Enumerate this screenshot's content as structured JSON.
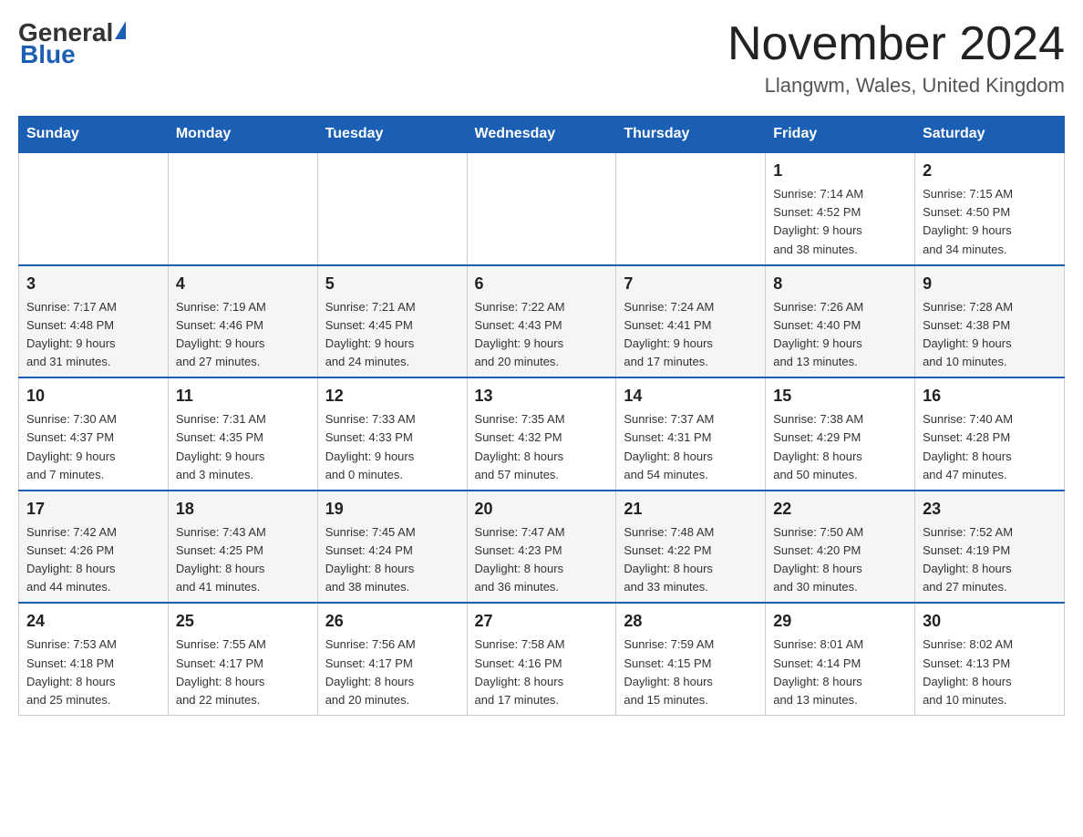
{
  "header": {
    "logo_general": "General",
    "logo_blue": "Blue",
    "month_title": "November 2024",
    "location": "Llangwm, Wales, United Kingdom"
  },
  "weekdays": [
    "Sunday",
    "Monday",
    "Tuesday",
    "Wednesday",
    "Thursday",
    "Friday",
    "Saturday"
  ],
  "weeks": [
    [
      {
        "day": "",
        "info": ""
      },
      {
        "day": "",
        "info": ""
      },
      {
        "day": "",
        "info": ""
      },
      {
        "day": "",
        "info": ""
      },
      {
        "day": "",
        "info": ""
      },
      {
        "day": "1",
        "info": "Sunrise: 7:14 AM\nSunset: 4:52 PM\nDaylight: 9 hours\nand 38 minutes."
      },
      {
        "day": "2",
        "info": "Sunrise: 7:15 AM\nSunset: 4:50 PM\nDaylight: 9 hours\nand 34 minutes."
      }
    ],
    [
      {
        "day": "3",
        "info": "Sunrise: 7:17 AM\nSunset: 4:48 PM\nDaylight: 9 hours\nand 31 minutes."
      },
      {
        "day": "4",
        "info": "Sunrise: 7:19 AM\nSunset: 4:46 PM\nDaylight: 9 hours\nand 27 minutes."
      },
      {
        "day": "5",
        "info": "Sunrise: 7:21 AM\nSunset: 4:45 PM\nDaylight: 9 hours\nand 24 minutes."
      },
      {
        "day": "6",
        "info": "Sunrise: 7:22 AM\nSunset: 4:43 PM\nDaylight: 9 hours\nand 20 minutes."
      },
      {
        "day": "7",
        "info": "Sunrise: 7:24 AM\nSunset: 4:41 PM\nDaylight: 9 hours\nand 17 minutes."
      },
      {
        "day": "8",
        "info": "Sunrise: 7:26 AM\nSunset: 4:40 PM\nDaylight: 9 hours\nand 13 minutes."
      },
      {
        "day": "9",
        "info": "Sunrise: 7:28 AM\nSunset: 4:38 PM\nDaylight: 9 hours\nand 10 minutes."
      }
    ],
    [
      {
        "day": "10",
        "info": "Sunrise: 7:30 AM\nSunset: 4:37 PM\nDaylight: 9 hours\nand 7 minutes."
      },
      {
        "day": "11",
        "info": "Sunrise: 7:31 AM\nSunset: 4:35 PM\nDaylight: 9 hours\nand 3 minutes."
      },
      {
        "day": "12",
        "info": "Sunrise: 7:33 AM\nSunset: 4:33 PM\nDaylight: 9 hours\nand 0 minutes."
      },
      {
        "day": "13",
        "info": "Sunrise: 7:35 AM\nSunset: 4:32 PM\nDaylight: 8 hours\nand 57 minutes."
      },
      {
        "day": "14",
        "info": "Sunrise: 7:37 AM\nSunset: 4:31 PM\nDaylight: 8 hours\nand 54 minutes."
      },
      {
        "day": "15",
        "info": "Sunrise: 7:38 AM\nSunset: 4:29 PM\nDaylight: 8 hours\nand 50 minutes."
      },
      {
        "day": "16",
        "info": "Sunrise: 7:40 AM\nSunset: 4:28 PM\nDaylight: 8 hours\nand 47 minutes."
      }
    ],
    [
      {
        "day": "17",
        "info": "Sunrise: 7:42 AM\nSunset: 4:26 PM\nDaylight: 8 hours\nand 44 minutes."
      },
      {
        "day": "18",
        "info": "Sunrise: 7:43 AM\nSunset: 4:25 PM\nDaylight: 8 hours\nand 41 minutes."
      },
      {
        "day": "19",
        "info": "Sunrise: 7:45 AM\nSunset: 4:24 PM\nDaylight: 8 hours\nand 38 minutes."
      },
      {
        "day": "20",
        "info": "Sunrise: 7:47 AM\nSunset: 4:23 PM\nDaylight: 8 hours\nand 36 minutes."
      },
      {
        "day": "21",
        "info": "Sunrise: 7:48 AM\nSunset: 4:22 PM\nDaylight: 8 hours\nand 33 minutes."
      },
      {
        "day": "22",
        "info": "Sunrise: 7:50 AM\nSunset: 4:20 PM\nDaylight: 8 hours\nand 30 minutes."
      },
      {
        "day": "23",
        "info": "Sunrise: 7:52 AM\nSunset: 4:19 PM\nDaylight: 8 hours\nand 27 minutes."
      }
    ],
    [
      {
        "day": "24",
        "info": "Sunrise: 7:53 AM\nSunset: 4:18 PM\nDaylight: 8 hours\nand 25 minutes."
      },
      {
        "day": "25",
        "info": "Sunrise: 7:55 AM\nSunset: 4:17 PM\nDaylight: 8 hours\nand 22 minutes."
      },
      {
        "day": "26",
        "info": "Sunrise: 7:56 AM\nSunset: 4:17 PM\nDaylight: 8 hours\nand 20 minutes."
      },
      {
        "day": "27",
        "info": "Sunrise: 7:58 AM\nSunset: 4:16 PM\nDaylight: 8 hours\nand 17 minutes."
      },
      {
        "day": "28",
        "info": "Sunrise: 7:59 AM\nSunset: 4:15 PM\nDaylight: 8 hours\nand 15 minutes."
      },
      {
        "day": "29",
        "info": "Sunrise: 8:01 AM\nSunset: 4:14 PM\nDaylight: 8 hours\nand 13 minutes."
      },
      {
        "day": "30",
        "info": "Sunrise: 8:02 AM\nSunset: 4:13 PM\nDaylight: 8 hours\nand 10 minutes."
      }
    ]
  ]
}
